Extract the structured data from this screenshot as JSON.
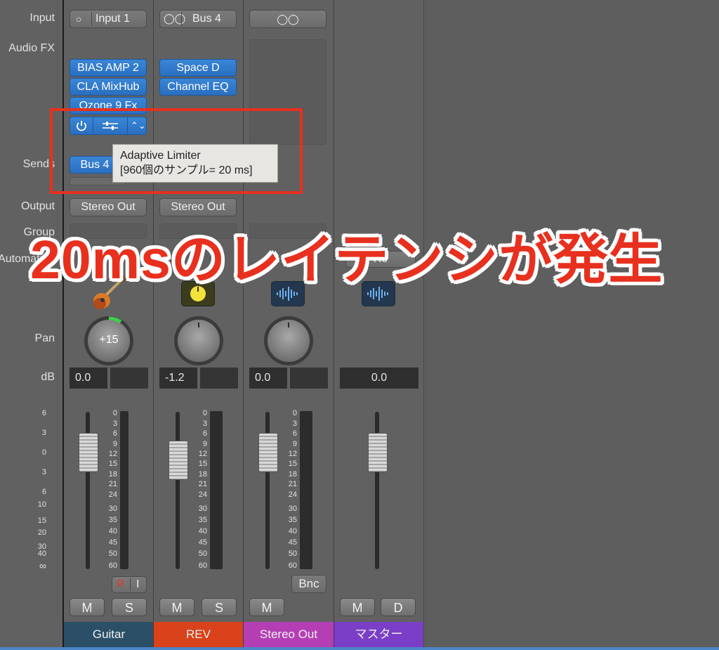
{
  "row_labels": {
    "input": "Input",
    "audio_fx": "Audio FX",
    "sends": "Sends",
    "output": "Output",
    "group": "Group",
    "automation": "Automation",
    "pan": "Pan",
    "db": "dB"
  },
  "strips": [
    {
      "name": "Guitar",
      "color": "#2a4f66",
      "input": "Input 1",
      "fx": [
        "BIAS AMP 2",
        "CLA MixHub",
        "Ozone 9 Fx"
      ],
      "send": "Bus 4",
      "output": "Stereo Out",
      "pan": "+15",
      "db": "0.0",
      "mute": "M",
      "solo": "S",
      "read": "R",
      "input_monitor": "I"
    },
    {
      "name": "REV",
      "color": "#d9421a",
      "input": "Bus 4",
      "fx": [
        "Space D",
        "Channel EQ"
      ],
      "output": "Stereo Out",
      "db": "-1.2",
      "mute": "M",
      "solo": "S"
    },
    {
      "name": "Stereo Out",
      "color": "#b43fb5",
      "db": "0.0",
      "mute": "M",
      "bounce": "Bnc"
    },
    {
      "name": "マスター",
      "color": "#7a3fc6",
      "automation": "Re",
      "db": "0.0",
      "mute": "M",
      "dim": "D"
    }
  ],
  "fader_scale": [
    "6",
    "3",
    "0",
    "3",
    "6",
    "10",
    "15",
    "20",
    "30",
    "40",
    "∞"
  ],
  "meter_scale": [
    "0",
    "3",
    "6",
    "9",
    "12",
    "15",
    "18",
    "21",
    "24",
    "30",
    "35",
    "40",
    "45",
    "50",
    "60"
  ],
  "tooltip": {
    "title": "Adaptive Limiter",
    "detail": "[960個のサンプル= 20 ms]"
  },
  "overlay_text": "20msのレイテンシが発生",
  "colors": {
    "fx_blue": "#2f78cc",
    "highlight_red": "#e8301e",
    "pan_green": "#3fcf4a"
  }
}
